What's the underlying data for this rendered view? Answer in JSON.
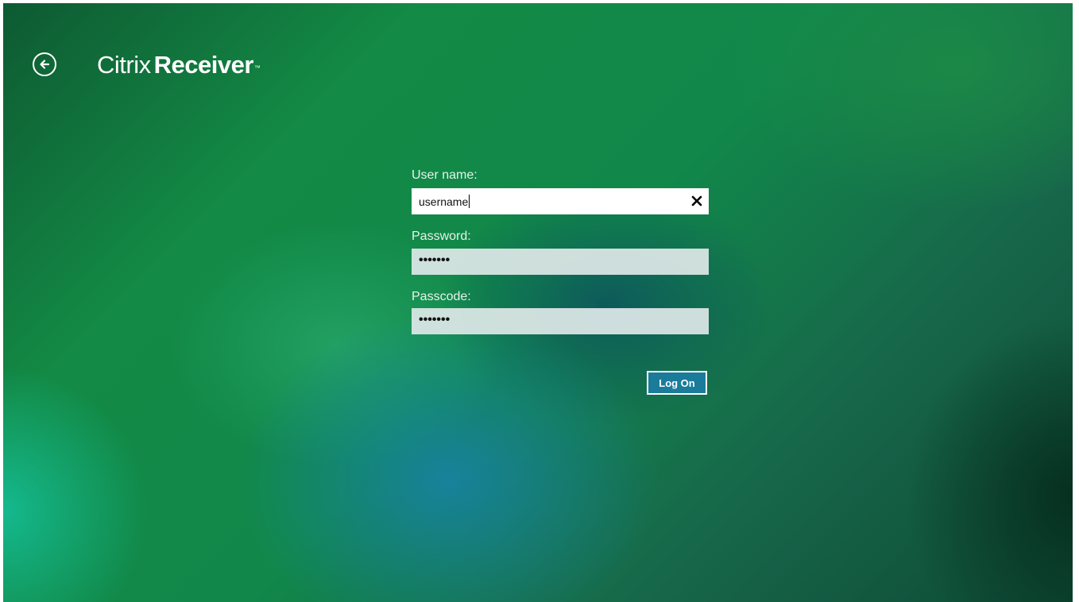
{
  "app": {
    "brand_light": "Citrix",
    "brand_bold": "Receiver",
    "brand_tm": "™"
  },
  "header": {
    "back_icon": "back-arrow-icon"
  },
  "form": {
    "username": {
      "label": "User name:",
      "value": "username",
      "clear_icon": "close-icon"
    },
    "password": {
      "label": "Password:",
      "masked_value": "•••••••"
    },
    "passcode": {
      "label": "Passcode:",
      "masked_value": "•••••••"
    },
    "submit_label": "Log On"
  },
  "colors": {
    "button_fill": "#1a7c9a",
    "background_primary": "#138a45"
  }
}
